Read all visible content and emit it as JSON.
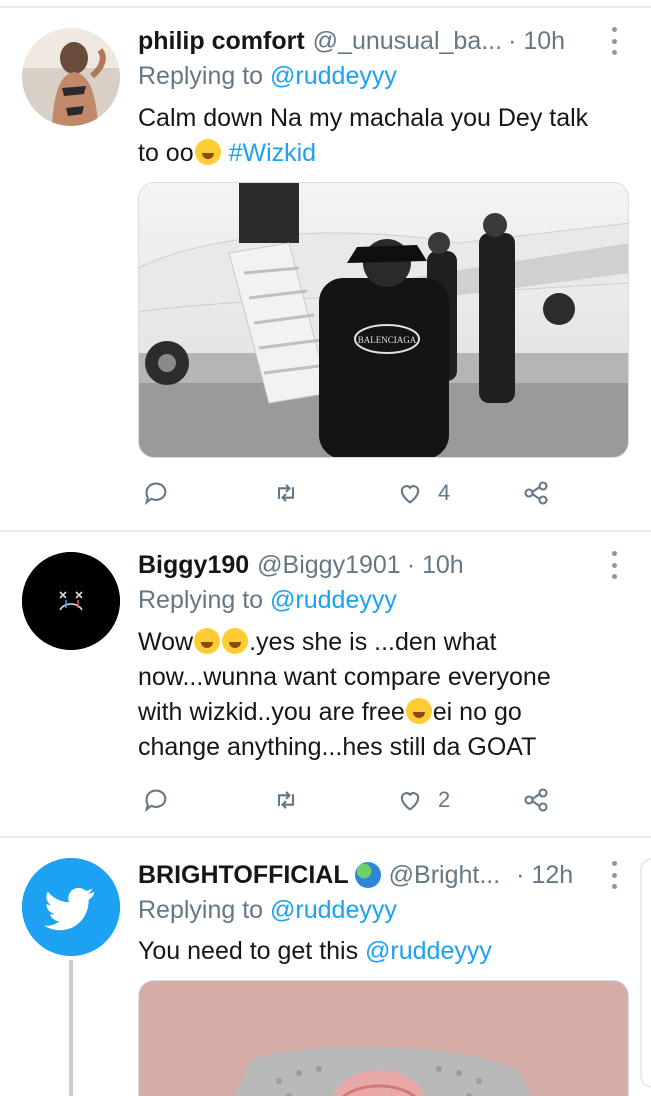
{
  "tweets": [
    {
      "display_name": "philip comfort",
      "handle": "@_unusual_ba...",
      "time": "· 10h",
      "replying_prefix": "Replying to ",
      "replying_to": "@ruddeyyy",
      "text_line1": "Calm down Na my machala you Dey talk",
      "text_line2": "to oo",
      "hashtag": "#Wizkid",
      "image_shirt_text": "BALENCIAGA",
      "reply_count": "",
      "retweet_count": "",
      "like_count": "4"
    },
    {
      "display_name": "Biggy190",
      "handle": "@Biggy1901",
      "time": "· 10h",
      "replying_prefix": "Replying to ",
      "replying_to": "@ruddeyyy",
      "text_a": "Wow",
      "text_b": ".yes she is ...den what",
      "text_line2": "now...wunna want compare everyone",
      "text_line3a": "with wizkid..you are free",
      "text_line3b": "ei no go",
      "text_line4": "change anything...hes still da GOAT",
      "like_count": "2"
    },
    {
      "display_name": "BRIGHTOFFICIAL",
      "handle": "@Bright...",
      "time": "· 12h",
      "replying_prefix": "Replying to ",
      "replying_to": "@ruddeyyy",
      "text": "You need to get this ",
      "mention": "@ruddeyyy"
    }
  ],
  "icons": [
    "reply-icon",
    "retweet-icon",
    "like-icon",
    "share-icon",
    "more-icon",
    "globe-emoji-icon",
    "twitter-bird-icon"
  ],
  "colors": {
    "link": "#1da1f2",
    "secondary": "#657786",
    "divider": "#e6ecf0",
    "twitter_blue": "#1da1f2"
  }
}
